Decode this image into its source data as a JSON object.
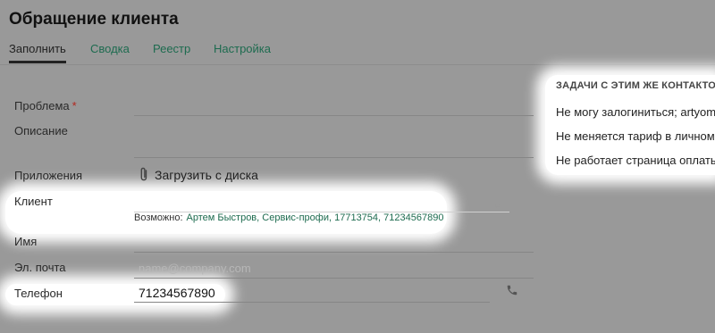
{
  "header": {
    "title": "Обращение клиента"
  },
  "tabs": [
    {
      "label": "Заполнить"
    },
    {
      "label": "Сводка"
    },
    {
      "label": "Реестр"
    },
    {
      "label": "Настройка"
    }
  ],
  "form": {
    "problem_label": "Проблема",
    "required_mark": "*",
    "description_label": "Описание",
    "attachments_label": "Приложения",
    "upload_label": "Загрузить с диска",
    "client_label": "Клиент",
    "suggestion_prefix": "Возможно:",
    "suggestion_link": "Артем Быстров, Сервис-профи, 17713754, 71234567890",
    "name_label": "Имя",
    "email_label": "Эл. почта",
    "email_placeholder": "name@company.com",
    "phone_label": "Телефон",
    "phone_value": "71234567890"
  },
  "sidebar": {
    "title": "ЗАДАЧИ С ЭТИМ ЖЕ КОНТАКТОМ",
    "items": [
      {
        "label": "Не могу залогиниться; artyom."
      },
      {
        "label": "Не меняется тариф в личном к"
      },
      {
        "label": "Не работает страница оплаты"
      }
    ]
  },
  "icons": {
    "attachment": "paperclip-icon",
    "dropdown": "chevron-down-icon",
    "phone": "phone-icon"
  },
  "colors": {
    "accent": "#1d6b4f",
    "required": "#b3261e",
    "overlay": "#999999",
    "highlight": "#ffffff"
  }
}
